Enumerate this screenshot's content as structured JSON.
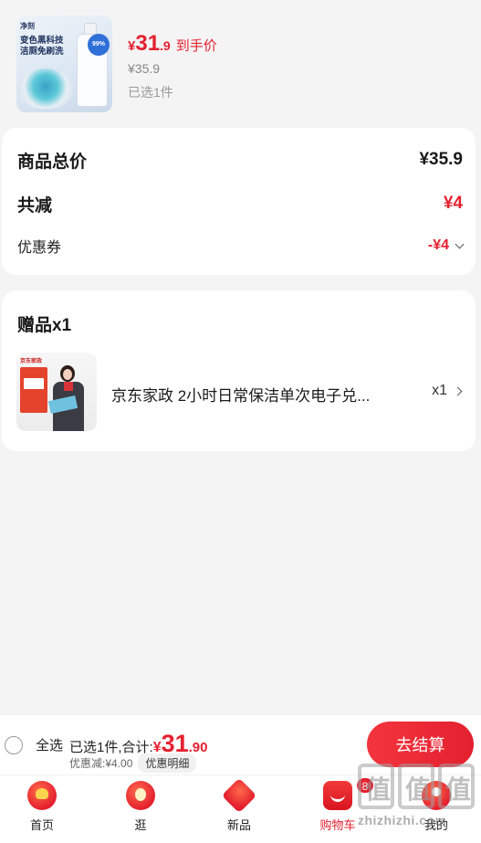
{
  "product": {
    "thumb_logo": "净刻",
    "thumb_line1": "变色黑科技",
    "thumb_line2": "洁厕免刷洗",
    "thumb_badge": "99%",
    "price_currency": "¥",
    "price_int": "31",
    "price_dec": ".9",
    "price_tag": "到手价",
    "original_price": "¥35.9",
    "selected_text": "已选1件"
  },
  "summary": {
    "total_label": "商品总价",
    "total_value": "¥35.9",
    "reduce_label": "共减",
    "reduce_value": "¥4",
    "coupon_label": "优惠券",
    "coupon_value": "-¥4"
  },
  "gift": {
    "title": "赠品x1",
    "thumb_header": "京东家政",
    "name": "京东家政 2小时日常保洁单次电子兑...",
    "quantity": "x1"
  },
  "checkout": {
    "select_all_label": "全选",
    "sum_prefix": "已选1件,合计:",
    "sum_currency": "¥",
    "sum_int": "31",
    "sum_dec": ".90",
    "discount_text": "优惠减:¥4.00",
    "detail_label": "优惠明细",
    "button_label": "去结算"
  },
  "tabbar": {
    "items": [
      {
        "label": "首页",
        "icon": "home-icon"
      },
      {
        "label": "逛",
        "icon": "browse-icon"
      },
      {
        "label": "新品",
        "icon": "new-products-icon"
      },
      {
        "label": "购物车",
        "icon": "cart-icon",
        "badge": "8",
        "active": true
      },
      {
        "label": "我的",
        "icon": "profile-icon"
      }
    ]
  },
  "watermark": {
    "text": "zhizhizhi.com"
  },
  "colors": {
    "accent": "#e4202f",
    "background": "#f4f4f4"
  }
}
